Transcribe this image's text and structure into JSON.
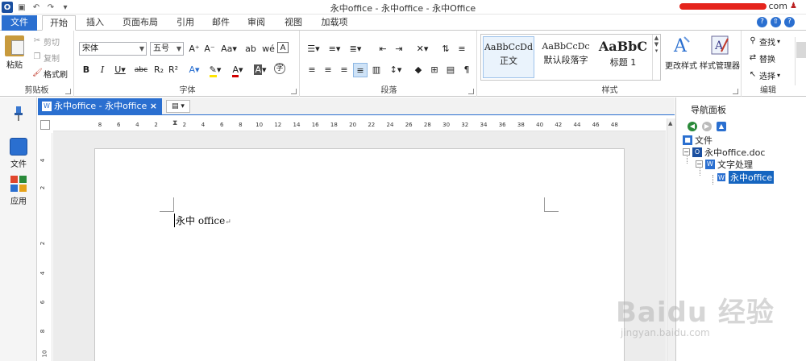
{
  "window": {
    "title": "永中office - 永中office - 永中Office",
    "user_suffix": "com"
  },
  "tabs": [
    "文件",
    "开始",
    "插入",
    "页面布局",
    "引用",
    "邮件",
    "审阅",
    "视图",
    "加载项"
  ],
  "ribbon": {
    "clipboard": {
      "label": "剪贴板",
      "paste": "粘贴",
      "cut": "剪切",
      "copy": "复制",
      "format_painter": "格式刷"
    },
    "font": {
      "label": "字体",
      "font_name": "宋体",
      "font_size": "五号"
    },
    "paragraph": {
      "label": "段落"
    },
    "styles": {
      "label": "样式",
      "items": [
        {
          "preview": "AaBbCcDd",
          "name": "正文"
        },
        {
          "preview": "AaBbCcDc",
          "name": "默认段落字"
        },
        {
          "preview": "AaBbC",
          "name": "标题 1"
        }
      ],
      "change_styles": "更改样式",
      "style_manager": "样式管理器"
    },
    "editing": {
      "label": "编辑",
      "find": "查找",
      "replace": "替换",
      "select": "选择"
    }
  },
  "left_pane": {
    "file": "文件",
    "apps": "应用"
  },
  "doc_tab": {
    "title": "永中office - 永中office"
  },
  "ruler": {
    "h_ticks": [
      "8",
      "6",
      "4",
      "2",
      "2",
      "4",
      "6",
      "8",
      "10",
      "12",
      "14",
      "16",
      "18",
      "20",
      "22",
      "24",
      "26",
      "28",
      "30",
      "32",
      "34",
      "36",
      "38",
      "40",
      "42",
      "44",
      "46",
      "48"
    ],
    "v_ticks": [
      "4",
      "2",
      "2",
      "4",
      "6",
      "8",
      "10"
    ]
  },
  "document": {
    "text": "永中 office"
  },
  "nav_pane": {
    "title": "导航面板",
    "tree": [
      "文件",
      "永中office.doc",
      "文字处理",
      "永中office"
    ]
  },
  "watermark": {
    "brand": "Baidu 经验",
    "url": "jingyan.baidu.com"
  },
  "colors": {
    "accent": "#2a6fd0",
    "selected": "#1565c0",
    "redaction": "#e5241c"
  }
}
